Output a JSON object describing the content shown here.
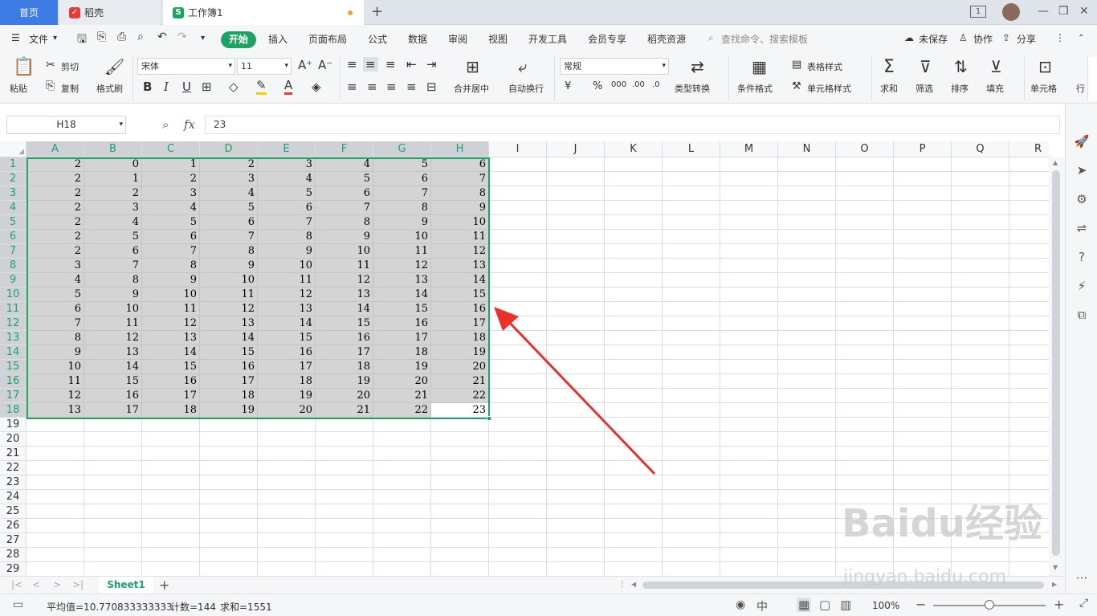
{
  "tabs": {
    "home": "首页",
    "daoke": "稻壳",
    "workbook": "工作簿1"
  },
  "window": {
    "page_indicator": "1"
  },
  "menu": {
    "file": "文件",
    "items": [
      "开始",
      "插入",
      "页面布局",
      "公式",
      "数据",
      "审阅",
      "视图",
      "开发工具",
      "会员专享",
      "稻壳资源"
    ],
    "search": "查找命令、搜索模板",
    "unsaved": "未保存",
    "collab": "协作",
    "share": "分享"
  },
  "ribbon": {
    "paste": "粘贴",
    "cut": "剪切",
    "copy": "复制",
    "format_painter": "格式刷",
    "font_name": "宋体",
    "font_size": "11",
    "merge_center": "合并居中",
    "wrap": "自动换行",
    "number_format": "常规",
    "type_convert": "类型转换",
    "cond_format": "条件格式",
    "table_style": "表格样式",
    "cell_style": "单元格样式",
    "sum": "求和",
    "filter": "筛选",
    "sort": "排序",
    "fill": "填充",
    "cell": "单元格",
    "row_col": "行"
  },
  "formula": {
    "name_box": "H18",
    "fx": "fx",
    "value": "23"
  },
  "columns": [
    "A",
    "B",
    "C",
    "D",
    "E",
    "F",
    "G",
    "H",
    "I",
    "J",
    "K",
    "L",
    "M",
    "N",
    "O",
    "P",
    "Q",
    "R"
  ],
  "rows": [
    "1",
    "2",
    "3",
    "4",
    "5",
    "6",
    "7",
    "8",
    "9",
    "10",
    "11",
    "12",
    "13",
    "14",
    "15",
    "16",
    "17",
    "18",
    "19",
    "20",
    "21",
    "22",
    "23",
    "24",
    "25",
    "26",
    "27",
    "28",
    "29"
  ],
  "cells": [
    [
      2,
      0,
      1,
      2,
      3,
      4,
      5,
      6
    ],
    [
      2,
      1,
      2,
      3,
      4,
      5,
      6,
      7
    ],
    [
      2,
      2,
      3,
      4,
      5,
      6,
      7,
      8
    ],
    [
      2,
      3,
      4,
      5,
      6,
      7,
      8,
      9
    ],
    [
      2,
      4,
      5,
      6,
      7,
      8,
      9,
      10
    ],
    [
      2,
      5,
      6,
      7,
      8,
      9,
      10,
      11
    ],
    [
      2,
      6,
      7,
      8,
      9,
      10,
      11,
      12
    ],
    [
      3,
      7,
      8,
      9,
      10,
      11,
      12,
      13
    ],
    [
      4,
      8,
      9,
      10,
      11,
      12,
      13,
      14
    ],
    [
      5,
      9,
      10,
      11,
      12,
      13,
      14,
      15
    ],
    [
      6,
      10,
      11,
      12,
      13,
      14,
      15,
      16
    ],
    [
      7,
      11,
      12,
      13,
      14,
      15,
      16,
      17
    ],
    [
      8,
      12,
      13,
      14,
      15,
      16,
      17,
      18
    ],
    [
      9,
      13,
      14,
      15,
      16,
      17,
      18,
      19
    ],
    [
      10,
      14,
      15,
      16,
      17,
      18,
      19,
      20
    ],
    [
      11,
      15,
      16,
      17,
      18,
      19,
      20,
      21
    ],
    [
      12,
      16,
      17,
      18,
      19,
      20,
      21,
      22
    ],
    [
      13,
      17,
      18,
      19,
      20,
      21,
      22,
      23
    ]
  ],
  "sheet": {
    "name": "Sheet1"
  },
  "status": {
    "average": "平均值=10.770833333333",
    "count": "计数=144",
    "sum": "求和=1551",
    "zoom": "100%"
  },
  "watermark": {
    "brand": "Baidu经验",
    "url": "jingyan.baidu.com"
  },
  "colors": {
    "accent": "#1ea365",
    "selection": "#d4d4d4",
    "arrow": "#e8322d",
    "home_tab": "#3d7be5"
  }
}
